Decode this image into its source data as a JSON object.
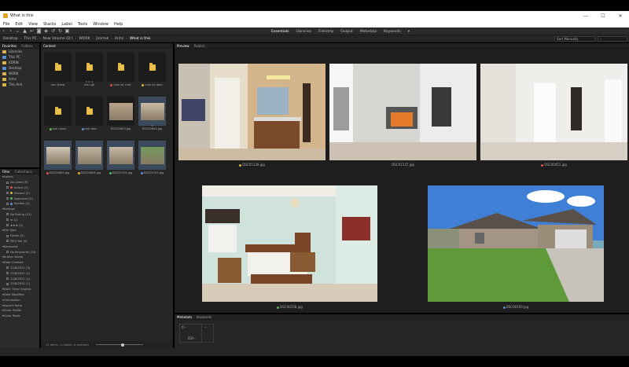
{
  "window": {
    "title": "What is this",
    "controls": [
      "—",
      "☐",
      "✕"
    ]
  },
  "menu": [
    "File",
    "Edit",
    "View",
    "Stacks",
    "Label",
    "Tools",
    "Window",
    "Help"
  ],
  "workspaces": [
    {
      "label": "Essentials",
      "active": true
    },
    {
      "label": "Libraries",
      "active": false
    },
    {
      "label": "Filmstrip",
      "active": false
    },
    {
      "label": "Output",
      "active": false
    },
    {
      "label": "Metadata",
      "active": false
    },
    {
      "label": "Keywords",
      "active": false
    }
  ],
  "breadcrumb": [
    "Desktop",
    "This PC",
    "New Volume (D:)",
    "WORK",
    "Jonrtek",
    "Anhs",
    "What is this"
  ],
  "sort_label": "Sort Manually",
  "search_placeholder": "",
  "favorites_panel": {
    "tabs": [
      "Favorites",
      "Folders"
    ],
    "items": [
      {
        "label": "Libraries",
        "color": "#d9b248"
      },
      {
        "label": "This PC",
        "color": "#5a8ed6"
      },
      {
        "label": "KDRIN",
        "color": "#d9b248"
      },
      {
        "label": "Desktop",
        "color": "#5a8ed6"
      },
      {
        "label": "WORK",
        "color": "#d9b248"
      },
      {
        "label": "Anhs",
        "color": "#d9b248"
      },
      {
        "label": "This Anh",
        "color": "#d9b248"
      }
    ]
  },
  "filter_panel": {
    "tabs": [
      "Filter",
      "Collections"
    ],
    "rows": [
      {
        "label": "Labels",
        "level": 0
      },
      {
        "label": "No Label (9)",
        "level": 1
      },
      {
        "label": "Select (3)",
        "level": 1,
        "dot": "#d9534f"
      },
      {
        "label": "Second (2)",
        "level": 1,
        "dot": "#e0b23a"
      },
      {
        "label": "Approved (2)",
        "level": 1,
        "dot": "#5cb85c"
      },
      {
        "label": "Review (2)",
        "level": 1,
        "dot": "#5a8ed6"
      },
      {
        "label": "Ratings",
        "level": 0
      },
      {
        "label": "No Rating (15)",
        "level": 1
      },
      {
        "label": "★ (2)",
        "level": 1
      },
      {
        "label": "★★★ (2)",
        "level": 1
      },
      {
        "label": "File Type",
        "level": 0
      },
      {
        "label": "Folder (5)",
        "level": 1
      },
      {
        "label": "JPEG file (9)",
        "level": 1
      },
      {
        "label": "Keywords",
        "level": 0
      },
      {
        "label": "No Keywords (14)",
        "level": 1
      },
      {
        "label": "Author Name",
        "level": 0
      },
      {
        "label": "Date Created",
        "level": 0
      },
      {
        "label": "12/8/2021 (3)",
        "level": 1
      },
      {
        "label": "12/8/2021 (1)",
        "level": 1
      },
      {
        "label": "12/8/2021 (1)",
        "level": 1
      },
      {
        "label": "12/8/2021 (1)",
        "level": 1
      },
      {
        "label": "Date Time Original",
        "level": 0
      },
      {
        "label": "Date Modified",
        "level": 0
      },
      {
        "label": "Orientation",
        "level": 0
      },
      {
        "label": "Aspect Ratio",
        "level": 0
      },
      {
        "label": "Color Profile",
        "level": 0
      },
      {
        "label": "Color Mode",
        "level": 0
      }
    ]
  },
  "content_panel": {
    "tabs": [
      "Content"
    ],
    "items": [
      {
        "type": "folder",
        "label": "nau trang",
        "dot": ""
      },
      {
        "type": "folder",
        "label": "mau gh",
        "dot": "",
        "stars": "★ ★ ★"
      },
      {
        "type": "folder",
        "label": "mau ke chat",
        "dot": "#d9534f"
      },
      {
        "type": "folder",
        "label": "mau ke dam",
        "dot": "#e0b23a"
      },
      {
        "type": "folder",
        "label": "mau khac",
        "dot": "#5cb85c"
      },
      {
        "type": "folder",
        "label": "anh dom",
        "dot": "#5a8ed6"
      },
      {
        "type": "image",
        "label": "DSC00603.jpg",
        "dot": "",
        "tone": "#b9a48b",
        "sel": false
      },
      {
        "type": "image",
        "label": "DSC00604.jpg",
        "dot": "",
        "tone": "#c9bba4",
        "sel": true,
        "stars": "★"
      },
      {
        "type": "image",
        "label": "DSC00605.jpg",
        "dot": "#d9534f",
        "tone": "#d2c6b6",
        "sel": true
      },
      {
        "type": "image",
        "label": "DSC00606.jpg",
        "dot": "#e0b23a",
        "tone": "#bfb3a0",
        "sel": true
      },
      {
        "type": "image",
        "label": "DSC00704.jpg",
        "dot": "#5cb85c",
        "tone": "#c7b9a5",
        "sel": true
      },
      {
        "type": "image",
        "label": "DSC00705.jpg",
        "dot": "#5a8ed6",
        "tone": "#6f9b5a",
        "sel": true
      }
    ],
    "footer": "12 items, 1 hidden, 6 selected"
  },
  "preview_panel": {
    "tabs": [
      "Preview",
      "Publish"
    ],
    "images": [
      {
        "caption": "DSC01139.jpg",
        "dot": "#e0b23a"
      },
      {
        "caption": "DSC01137.jpg",
        "dot": ""
      },
      {
        "caption": "DSC00451.jpg",
        "dot": "#d9534f"
      },
      {
        "caption": "DSC00158.jpg",
        "dot": "#5cb85c"
      },
      {
        "caption": "DSC00159.jpg",
        "dot": "#5a8ed6"
      }
    ]
  },
  "metadata_panel": {
    "tabs": [
      "Metadata",
      "Keywords"
    ],
    "aperture": "f/--",
    "iso": "ISO--",
    "dashes": "--"
  },
  "colors": {
    "label_select": "#d9534f",
    "label_second": "#e0b23a",
    "label_approved": "#5cb85c",
    "label_review": "#5a8ed6",
    "folder": "#e9bf4a"
  }
}
